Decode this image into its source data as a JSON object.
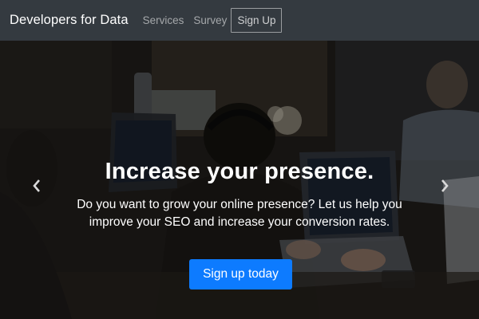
{
  "navbar": {
    "brand": "Developers for Data",
    "links": [
      "Services",
      "Survey"
    ],
    "signup_label": "Sign Up"
  },
  "hero": {
    "headline": "Increase your presence.",
    "description": "Do you want to grow your online presence? Let us help you improve your SEO and increase your conversion rates.",
    "cta_label": "Sign up today",
    "prev_icon": "chevron-left-icon",
    "next_icon": "chevron-right-icon"
  },
  "colors": {
    "navbar_bg": "#343a40",
    "cta_bg": "#0d7bff"
  }
}
